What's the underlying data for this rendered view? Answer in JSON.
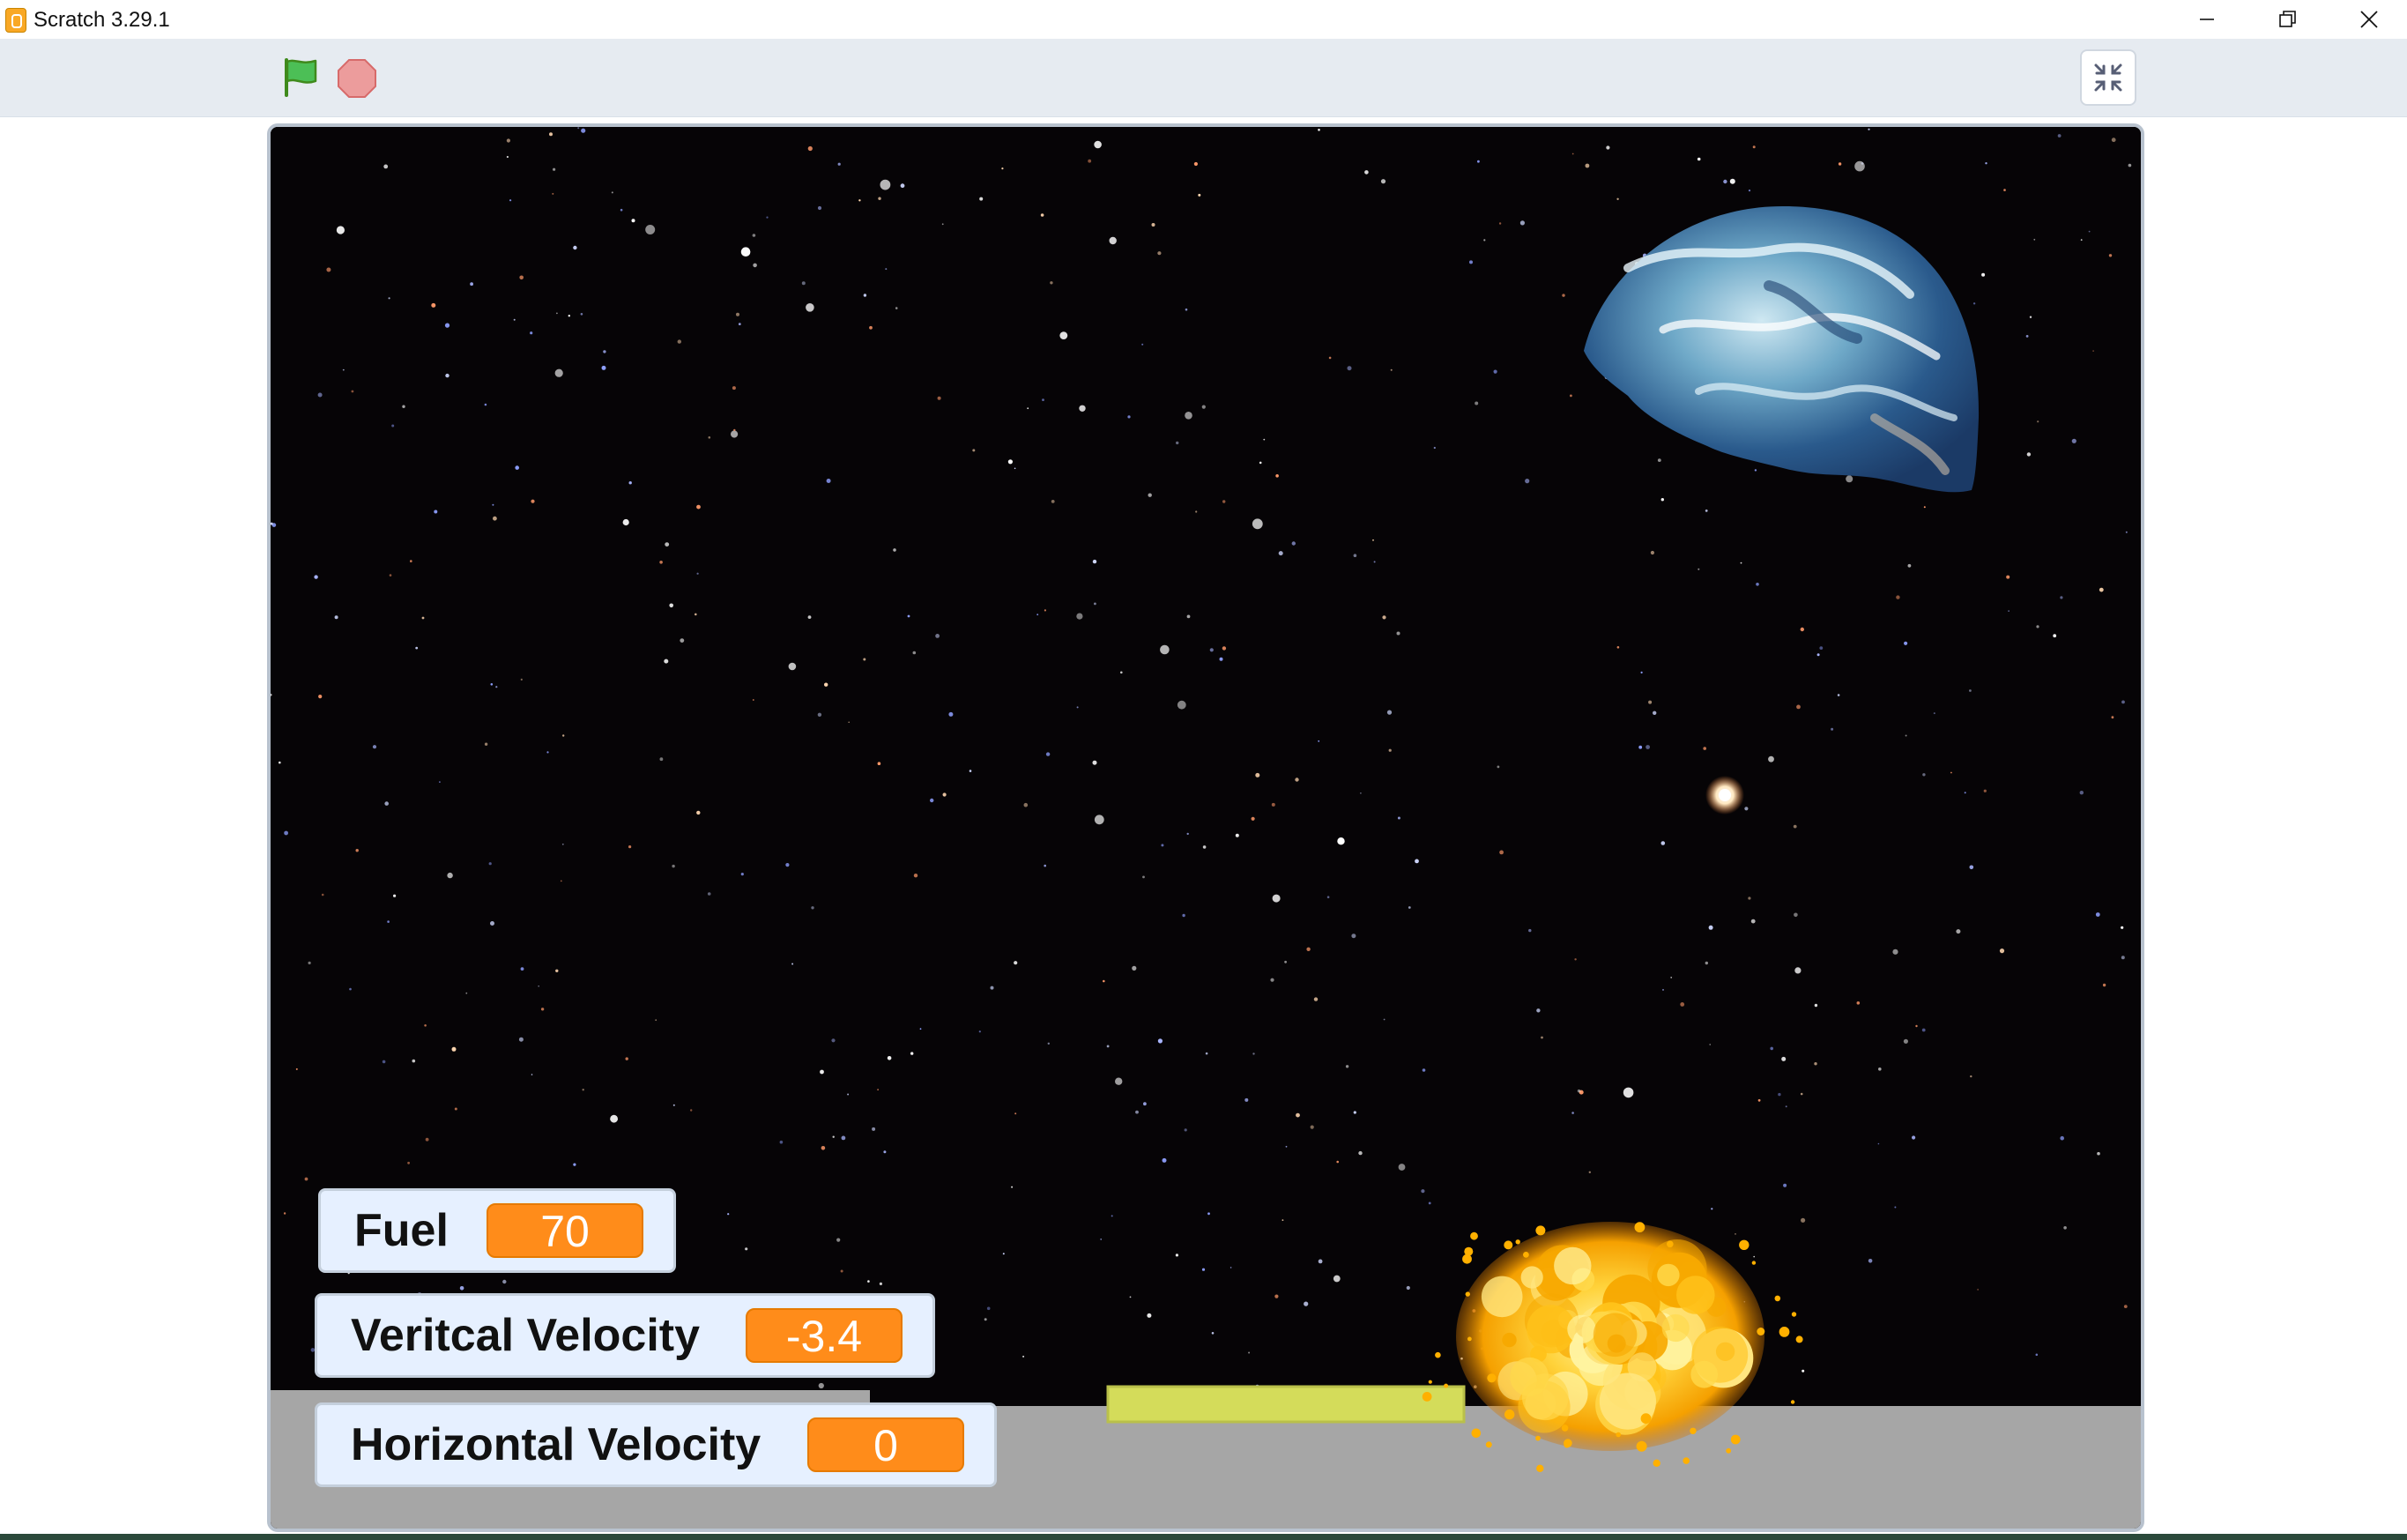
{
  "window": {
    "title": "Scratch 3.29.1",
    "controls": [
      "minimize",
      "restore",
      "close"
    ]
  },
  "toolbar": {
    "green_flag_icon": "green-flag-icon",
    "stop_icon": "stop-icon",
    "unfullscreen_icon": "unfullscreen-icon"
  },
  "stage": {
    "backdrop": "stars",
    "sprites": [
      "earth",
      "landing-pad",
      "explosion",
      "ground"
    ],
    "monitors": [
      {
        "label": "Fuel",
        "value": "70"
      },
      {
        "label": "Veritcal Velocity",
        "value": "-3.4"
      },
      {
        "label": "Horizontal Velocity",
        "value": "0"
      }
    ]
  },
  "colors": {
    "monitor_value_bg": "#ff8c1a",
    "monitor_bg": "#e6f0ff",
    "ground": "#a6a6a6",
    "landing_pad": "#d4dc5a",
    "menubar": "#e6ebf1"
  }
}
